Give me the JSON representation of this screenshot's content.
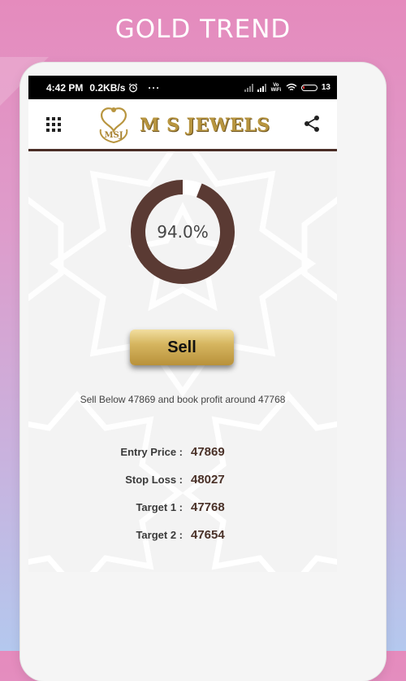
{
  "promo": {
    "title": "GOLD TREND"
  },
  "status_bar": {
    "time": "4:42 PM",
    "speed": "0.2KB/s",
    "more": "···",
    "volte": "Vo WiFi",
    "battery": "13"
  },
  "app_bar": {
    "brand": "M S JEWELS",
    "logo_mark": "MSJ"
  },
  "signal": {
    "type": "Sell",
    "progress_percent": 94.0,
    "progress_label": "94.0%"
  },
  "advice": "Sell Below 47869 and book profit around 47768",
  "details": [
    {
      "label": "Entry Price :",
      "value": "47869"
    },
    {
      "label": "Stop Loss :",
      "value": "48027"
    },
    {
      "label": "Target 1 :",
      "value": "47768"
    },
    {
      "label": "Target 2 :",
      "value": "47654"
    }
  ],
  "icons": {
    "menu": "grid-menu-icon",
    "share": "share-icon",
    "alarm": "alarm-clock-icon",
    "wifi": "wifi-icon"
  },
  "colors": {
    "brand_brown": "#4a2d26",
    "gold": "#b8953f",
    "donut_track": "#5a3a33"
  }
}
